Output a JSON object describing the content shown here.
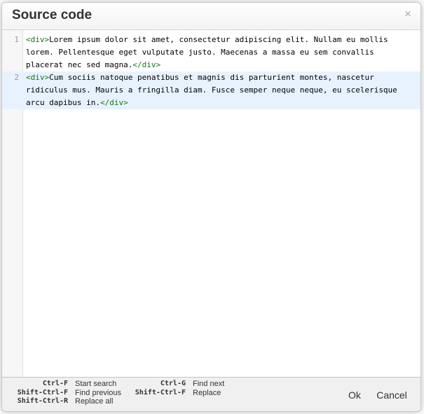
{
  "dialog": {
    "title": "Source code",
    "close_glyph": "×"
  },
  "editor": {
    "lines": [
      {
        "number": "1",
        "open_tag": "<div>",
        "text": "Lorem ipsum dolor sit amet, consectetur adipiscing elit. Nullam eu mollis lorem. Pellentesque eget vulputate justo. Maecenas a massa eu sem convallis placerat nec sed magna.",
        "close_tag": "</div>"
      },
      {
        "number": "2",
        "open_tag": "<div>",
        "text": "Cum sociis natoque penatibus et magnis dis parturient montes, nascetur ridiculus mus. Mauris a fringilla diam. Fusce semper neque neque, eu scelerisque arcu dapibus in.",
        "close_tag": "</div>"
      }
    ],
    "active_line": 2
  },
  "shortcuts": [
    {
      "key": "Ctrl-F",
      "desc": "Start search",
      "key2": "Ctrl-G",
      "desc2": "Find next"
    },
    {
      "key": "Shift-Ctrl-F",
      "desc": "Find previous",
      "key2": "Shift-Ctrl-F",
      "desc2": "Replace"
    },
    {
      "key": "Shift-Ctrl-R",
      "desc": "Replace all"
    }
  ],
  "buttons": {
    "ok_label": "Ok",
    "cancel_label": "Cancel"
  },
  "colors": {
    "tag": "#117711",
    "active_line": "#e8f2ff"
  }
}
